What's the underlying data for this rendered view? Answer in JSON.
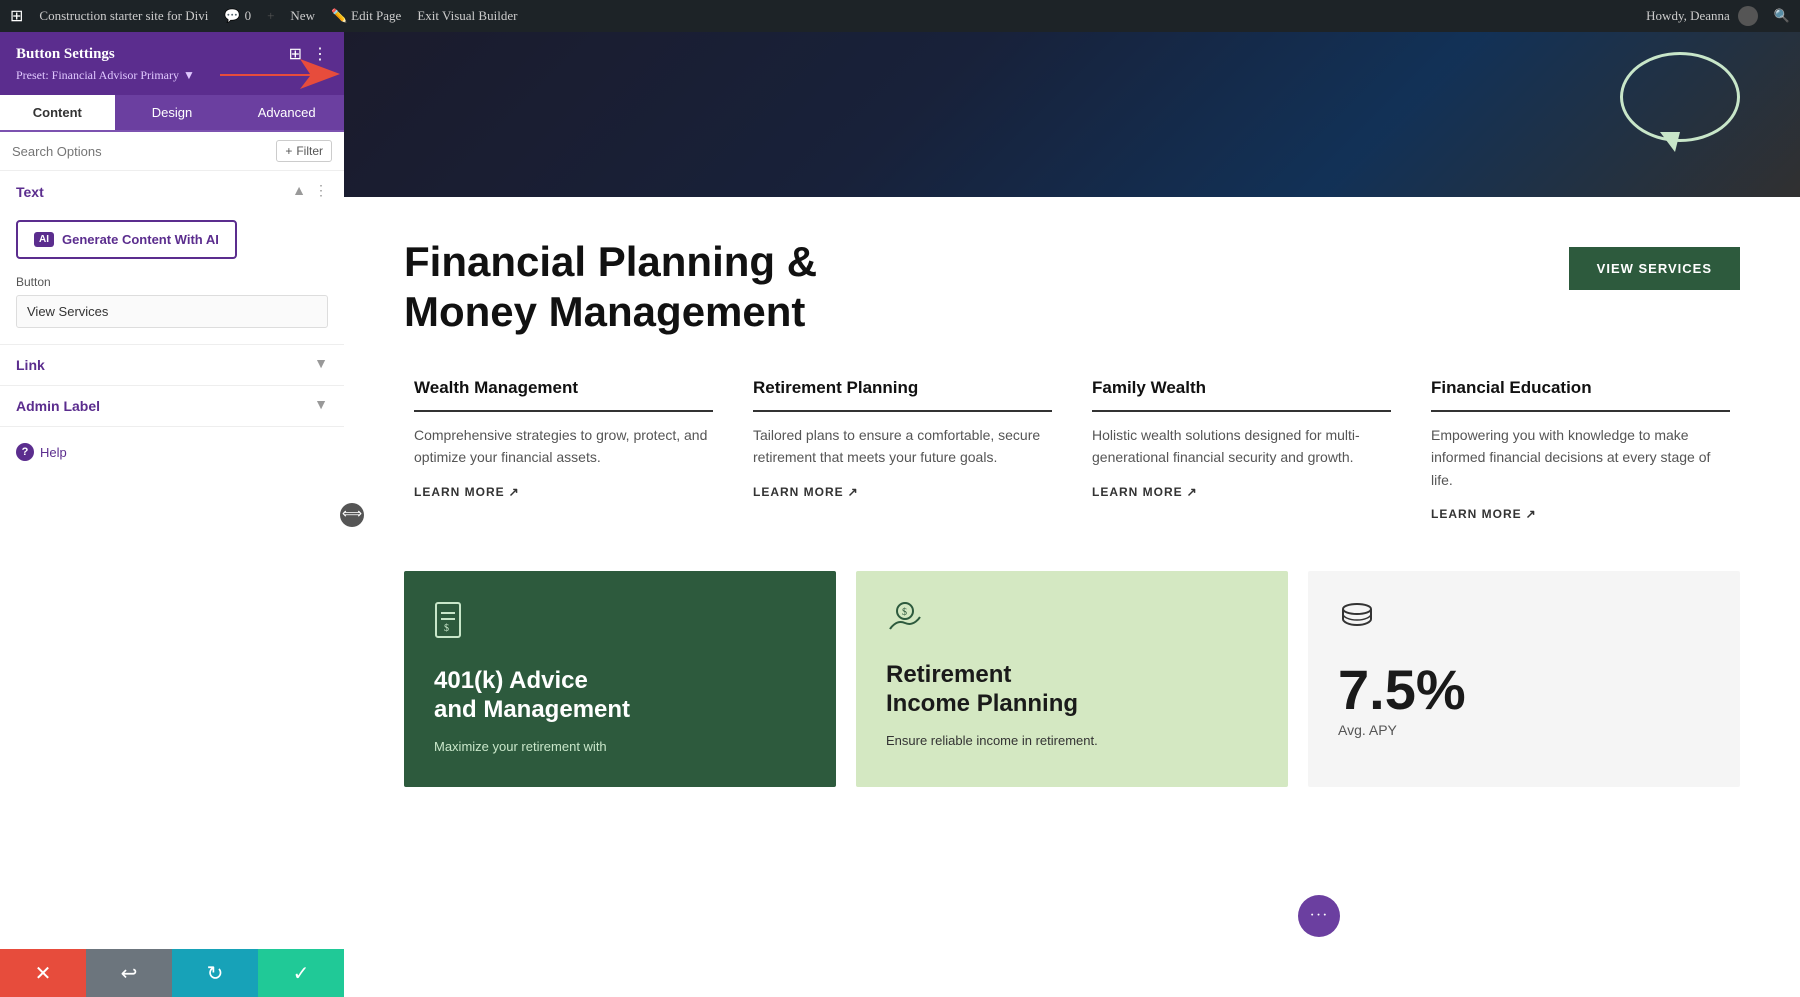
{
  "wp_bar": {
    "site_name": "Construction starter site for Divi",
    "comments": "0",
    "new_label": "New",
    "edit_page": "Edit Page",
    "exit_builder": "Exit Visual Builder",
    "howdy": "Howdy, Deanna"
  },
  "panel": {
    "title": "Button Settings",
    "preset": "Preset: Financial Advisor Primary",
    "tabs": [
      {
        "id": "content",
        "label": "Content"
      },
      {
        "id": "design",
        "label": "Design"
      },
      {
        "id": "advanced",
        "label": "Advanced"
      }
    ],
    "active_tab": "content",
    "search_placeholder": "Search Options",
    "filter_label": "Filter",
    "sections": {
      "text": {
        "label": "Text",
        "ai_button_label": "Generate Content With AI",
        "ai_badge": "AI",
        "field_label": "Button",
        "field_value": "View Services"
      },
      "link": {
        "label": "Link"
      },
      "admin_label": {
        "label": "Admin Label"
      }
    },
    "help_label": "Help",
    "bottom_buttons": {
      "cancel": "✕",
      "undo": "↩",
      "redo": "↻",
      "save": "✓"
    }
  },
  "page": {
    "hero_heading_line1": "Financial Planning &",
    "hero_heading_line2": "Money Management",
    "view_services_btn": "VIEW SERVICES",
    "services": [
      {
        "title": "Wealth Management",
        "text": "Comprehensive strategies to grow, protect, and optimize your financial assets.",
        "learn_more": "LEARN MORE"
      },
      {
        "title": "Retirement Planning",
        "text": "Tailored plans to ensure a comfortable, secure retirement that meets your future goals.",
        "learn_more": "LEARN MORE"
      },
      {
        "title": "Family Wealth",
        "text": "Holistic wealth solutions designed for multi-generational financial security and growth.",
        "learn_more": "LEARN MORE"
      },
      {
        "title": "Financial Education",
        "text": "Empowering you with knowledge to make informed financial decisions at every stage of life.",
        "learn_more": "LEARN MORE"
      }
    ],
    "cards": [
      {
        "type": "dark",
        "icon": "📄",
        "title_line1": "401(k) Advice",
        "title_line2": "and Management",
        "text": "Maximize your retirement with"
      },
      {
        "type": "light",
        "icon": "💰",
        "title_line1": "Retirement",
        "title_line2": "Income Planning",
        "text": "Ensure reliable income in retirement."
      },
      {
        "type": "white",
        "stat": "7.5%",
        "stat_label": "Avg. APY"
      }
    ]
  }
}
